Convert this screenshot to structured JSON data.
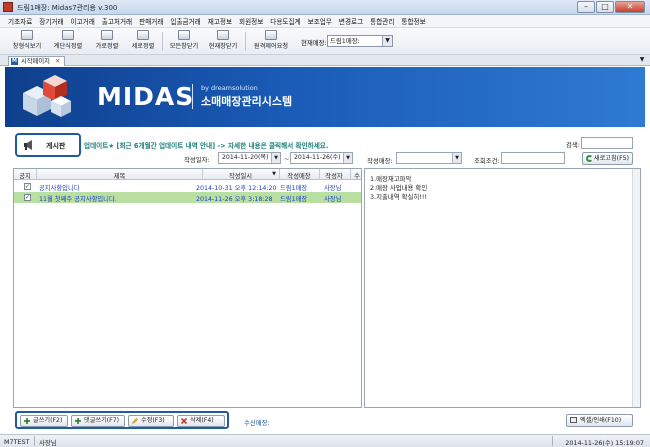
{
  "window": {
    "title": "드림1매장: Midas7관리용 v.300",
    "minimize": "–",
    "maximize": "□",
    "close": "✕"
  },
  "menu": [
    "기초자료",
    "장기거래",
    "이고거래",
    "출고처거래",
    "판매거래",
    "입출금거래",
    "재고정보",
    "회원정보",
    "다용도집계",
    "보조업무",
    "변경로그",
    "통합관리",
    "통합정보"
  ],
  "toolbar": {
    "buttons": [
      "창형식보기",
      "계단식정렬",
      "가로정렬",
      "세로정렬",
      "모든창닫기",
      "현재창닫기",
      "원격제어요청"
    ],
    "store_label": "현재매장:",
    "store_value": "드림1매장:"
  },
  "tabs": {
    "start_page": "시작페이지",
    "close_glyph": "✕",
    "tab_icon_letter": "M"
  },
  "banner": {
    "logo": "MIDAS",
    "by": "by dreamsolution",
    "subtitle": "소매매장관리시스템"
  },
  "board": {
    "title": "게시판",
    "notice": "업데이트★ [최근 6개월간 업데이트 내역 안내] -> 자세한 내용은 클릭해서 확인하세요.",
    "search_label": "검색:",
    "search_value": "",
    "date_label": "작성일자:",
    "date_from": "2014-11-20(목)",
    "date_sep": "~",
    "date_to": "2014-11-26(수)",
    "writer_store_label": "작성매장:",
    "writer_store_value": "",
    "query_label": "조회조건:",
    "query_value": "",
    "refresh_button": "새로고침(F5)"
  },
  "list": {
    "columns": [
      "공지",
      "제목",
      "작성일시",
      "작성매장",
      "작성자",
      "수"
    ],
    "rows": [
      {
        "checked": true,
        "title": "공지사항입니다",
        "datetime": "2014-10-31 오후 12:14:20",
        "store": "드림1매장",
        "author": "사장님",
        "selected": false
      },
      {
        "checked": true,
        "title": "11월 첫째주 공지사항입니다.",
        "datetime": "2014-11-26 오후 3:18:28",
        "store": "드림1매장",
        "author": "사장님",
        "selected": true
      }
    ],
    "check_glyph": "✓"
  },
  "content": {
    "lines": [
      "1.매장재고파악",
      "2.매장 사업내용 확인",
      "3.지출내역 확실히!!!"
    ]
  },
  "actions": {
    "write": "글쓰기(F2)",
    "reply": "댓글쓰기(F7)",
    "edit": "수정(F3)",
    "delete": "삭제(F4)",
    "receive_store_label": "수신매장:",
    "excel_print": "엑셀/인쇄(F10)"
  },
  "status": {
    "code": "M7TEST",
    "user": "사장님",
    "datetime": "2014-11-26(수) 15:19:07"
  },
  "colors": {
    "accent": "#1f5aa6",
    "banner_start": "#0f3f8c",
    "banner_end": "#2f7ad3",
    "selected_row": "#b9dfa3",
    "link_text": "#1a3fc6",
    "notice_text": "#1c7f7a"
  }
}
